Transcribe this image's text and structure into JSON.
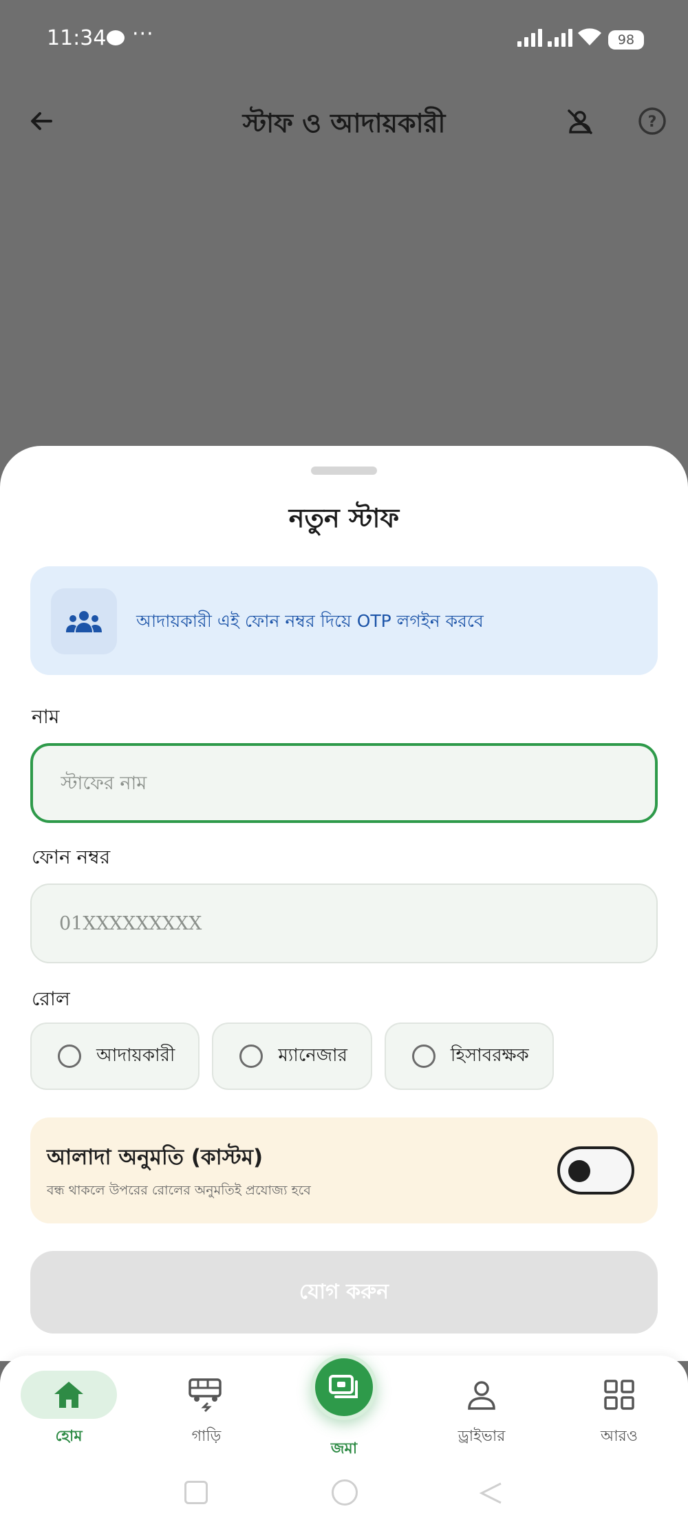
{
  "status_bar": {
    "time": "11:34",
    "more": "···",
    "battery": "98"
  },
  "app_bar": {
    "title": "স্টাফ ও আদায়কারী"
  },
  "sheet": {
    "title": "নতুন স্টাফ",
    "info_text": "আদায়কারী এই ফোন নম্বর দিয়ে OTP লগইন করবে",
    "name_label": "নাম",
    "name_placeholder": "স্টাফের নাম",
    "phone_label": "ফোন নম্বর",
    "phone_placeholder": "01XXXXXXXXX",
    "role_label": "রোল",
    "roles": [
      "আদায়কারী",
      "ম্যানেজার",
      "হিসাবরক্ষক"
    ],
    "custom_title": "আলাদা অনুমতি (কাস্টম)",
    "custom_subtitle": "বন্ধ থাকলে উপরের রোলের অনুমতিই প্রযোজ্য হবে",
    "custom_toggle_on": false,
    "submit_label": "যোগ করুন"
  },
  "bottom_nav": {
    "items": [
      {
        "label": "হোম",
        "icon": "home-icon",
        "active": true
      },
      {
        "label": "গাড়ি",
        "icon": "bus-icon",
        "active": false
      },
      {
        "label": "জমা",
        "icon": "cash-icon",
        "active": false
      },
      {
        "label": "ড্রাইভার",
        "icon": "person-icon",
        "active": false
      },
      {
        "label": "আরও",
        "icon": "grid-icon",
        "active": false
      }
    ]
  },
  "colors": {
    "primary": "#2e9a4a",
    "info_bg": "#e2eefb",
    "info_text": "#1c54a8",
    "custom_bg": "#fcf3e1"
  }
}
